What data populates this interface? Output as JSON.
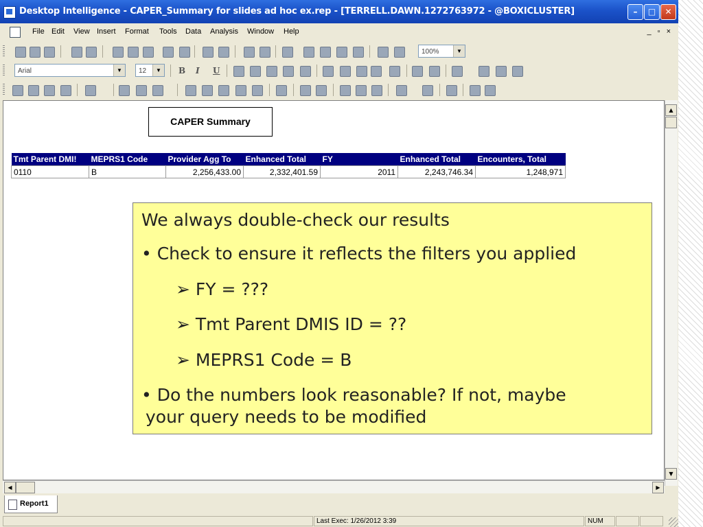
{
  "window": {
    "title": "Desktop Intelligence - CAPER_Summary for slides ad hoc ex.rep - [TERRELL.DAWN.1272763972 - @BOXICLUSTER]",
    "controls": {
      "minimize": "–",
      "maximize": "□",
      "close": "✕"
    }
  },
  "menubar": {
    "items": [
      "File",
      "Edit",
      "View",
      "Insert",
      "Format",
      "Tools",
      "Data",
      "Analysis",
      "Window",
      "Help"
    ],
    "mdi_controls": "_ ▫ ×"
  },
  "toolbar": {
    "zoom": "100%",
    "font_name": "Arial",
    "font_size": "12",
    "format_buttons": [
      "B",
      "I",
      "U"
    ]
  },
  "report": {
    "title": "CAPER Summary",
    "table": {
      "headers": [
        "Tmt Parent DMI!",
        "MEPRS1 Code",
        "Provider Agg To",
        "Enhanced Total",
        "FY",
        "Enhanced Total",
        "Encounters,  Total"
      ],
      "rows": [
        [
          "0110",
          "B",
          "2,256,433.00",
          "2,332,401.59",
          "2011",
          "2,243,746.34",
          "1,248,971"
        ]
      ]
    }
  },
  "callout": {
    "heading": "We always double-check our results",
    "bullet1": "• Check to ensure it reflects the filters you applied",
    "sub_items": [
      "➢  FY = ???",
      "➢  Tmt Parent DMIS ID = ??",
      "➢  MEPRS1 Code = B"
    ],
    "bullet2_line1": "•  Do the numbers look reasonable?  If not, maybe",
    "bullet2_line2": "your query needs to be modified"
  },
  "tabs": [
    "Report1"
  ],
  "status": {
    "last_exec": "Last Exec: 1/26/2012 3:39",
    "num": "NUM"
  }
}
